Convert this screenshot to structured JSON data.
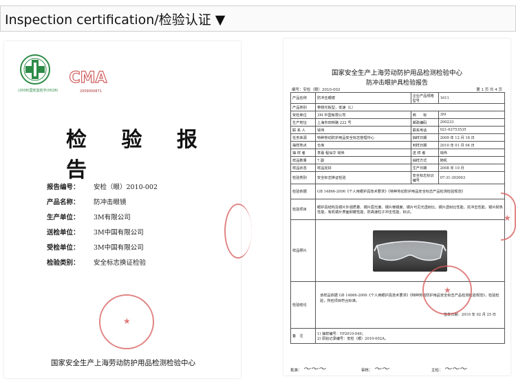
{
  "header": {
    "title": "Inspection certification/检验认证 ▼"
  },
  "cover": {
    "seal_caption": "(2008)国安监检字(0028)",
    "cma_text": "CMA",
    "cma_number": "2009000871",
    "title": "检 验 报 告",
    "fields": [
      {
        "label": "报告编号：",
        "value": "安检（眼）2010-002"
      },
      {
        "label": "产品名称：",
        "value": "防冲击眼镜"
      },
      {
        "label": "生产单位：",
        "value": "3M有限公司"
      },
      {
        "label": "送检单位：",
        "value": "3M中国有限公司"
      },
      {
        "label": "受检单位：",
        "value": "3M中国有限公司"
      },
      {
        "label": "检验类别：",
        "value": "安全标志换证检验"
      }
    ],
    "footer": "国家安全生产上海劳动防护用品检测检验中心"
  },
  "report": {
    "title": "国家安全生产上海劳动防护用品检测检验中心",
    "subtitle": "防冲击眼护具检验报告",
    "number": "编号：安检（眼）2010-002",
    "page": "第 1 页 共 4 页",
    "rows": [
      [
        "产品名称",
        "防冲击眼镜",
        "企业产品规格型号",
        "1611"
      ],
      [
        "产品类别",
        "带侧光板型，低速（L）",
        "",
        ""
      ],
      [
        "受检单位",
        "3M 中国有限公司",
        "商　　标",
        "3M"
      ],
      [
        "生产地址",
        "上海市田林路 222 号",
        "邮政编码",
        "200233"
      ],
      [
        "联 系 人",
        "钱伟",
        "联系电话",
        "021-62753535"
      ],
      [
        "任务来源",
        "特种劳动防护用品安全标志管理中心",
        "抽样日期",
        "2009 年 12 月 18 日"
      ],
      [
        "抽样地点",
        "仓库",
        "到样日期",
        "2010 年 01 月 04 日"
      ],
      [
        "抽 样 者",
        "李嘉 程仙华 钱伟",
        "送 样 者",
        "钱伟"
      ],
      [
        "样品数量",
        "7 副",
        "抽样方式",
        "随机"
      ],
      [
        "样品状态",
        "样品完好",
        "生产日期",
        "2008 年 10 月"
      ],
      [
        "检验类别",
        "安全标志换证检验",
        "安全标志标识编号",
        "07-31-303003"
      ]
    ],
    "basis_label": "检验依据",
    "basis": "GB 14866-2006《个人用眼护具技术要求》《特种劳动防护用品安全标志产品检测检验规范》",
    "items_label": "检验项目",
    "items": "眼护具结构及镜片外观质量、镜片屈光度、镜片棱镜度、镜片可见光透射比、镜片透射比性能、抗冲击性能、镜片耐热性能、有机镜片表面耐磨性能、防高速粒子冲击性能、标识。",
    "photo_label": "样品照片",
    "conclusion_label": "检验结论",
    "conclusion": "该样品依据 GB 14866-2006《个人用眼护具技术要求》《特种劳动防护用品安全标志产品检测检验规范》，检验检验，所检项目符合标准。",
    "issue_date": "签发日期：2010 年 02 月 25 日",
    "remark_label": "备　注",
    "remarks": [
      "1) 抽样编号：YP2010-049；",
      "2) 原始记录编号：安检（眼）2010-002A。"
    ],
    "approver_label": "批准：",
    "reviewer_label": "审核：",
    "main_inspector_label": "主检："
  },
  "colors": {
    "stamp_red": "#d75a5a",
    "seal_green": "#2c8a47"
  }
}
